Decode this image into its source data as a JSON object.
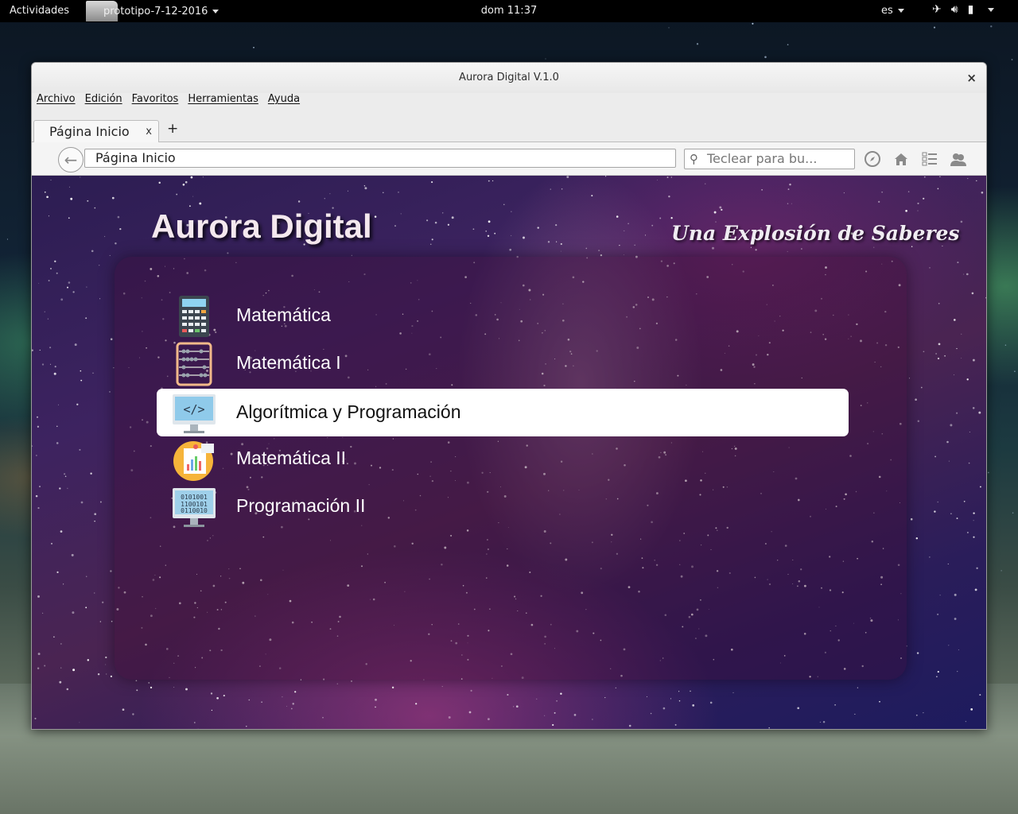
{
  "topbar": {
    "activities": "Actividades",
    "app_name": "prototipo-7-12-2016",
    "clock": "dom 11:37",
    "language": "es",
    "icons": [
      "airplane-icon",
      "volume-icon",
      "battery-icon",
      "power-caret-icon"
    ]
  },
  "window": {
    "title": "Aurora Digital V.1.0",
    "close": "×"
  },
  "menubar": [
    "Archivo",
    "Edición",
    "Favoritos",
    "Herramientas",
    "Ayuda"
  ],
  "tabs": [
    {
      "label": "Página Inicio",
      "close": "x"
    }
  ],
  "tab_add": "+",
  "navbar": {
    "url": "Página Inicio",
    "search_placeholder": "Teclear para bu...",
    "icons": [
      "compass-icon",
      "home-icon",
      "list-icon",
      "users-icon"
    ]
  },
  "page": {
    "title": "Aurora Digital",
    "tagline": "Una Explosión de Saberes",
    "items": [
      {
        "label": "Matemática",
        "icon": "calculator-icon",
        "active": false
      },
      {
        "label": "Matemática I",
        "icon": "abacus-icon",
        "active": false
      },
      {
        "label": "Algorítmica y Programación",
        "icon": "code-monitor-icon",
        "active": true
      },
      {
        "label": "Matemática II",
        "icon": "report-chart-icon",
        "active": false
      },
      {
        "label": "Programación II",
        "icon": "binary-monitor-icon",
        "active": false
      }
    ]
  },
  "colors": {
    "panel_bg": "#000000",
    "window_bg": "#ececec",
    "content_purple": "#3d2360",
    "active_item_bg": "#ffffff"
  }
}
